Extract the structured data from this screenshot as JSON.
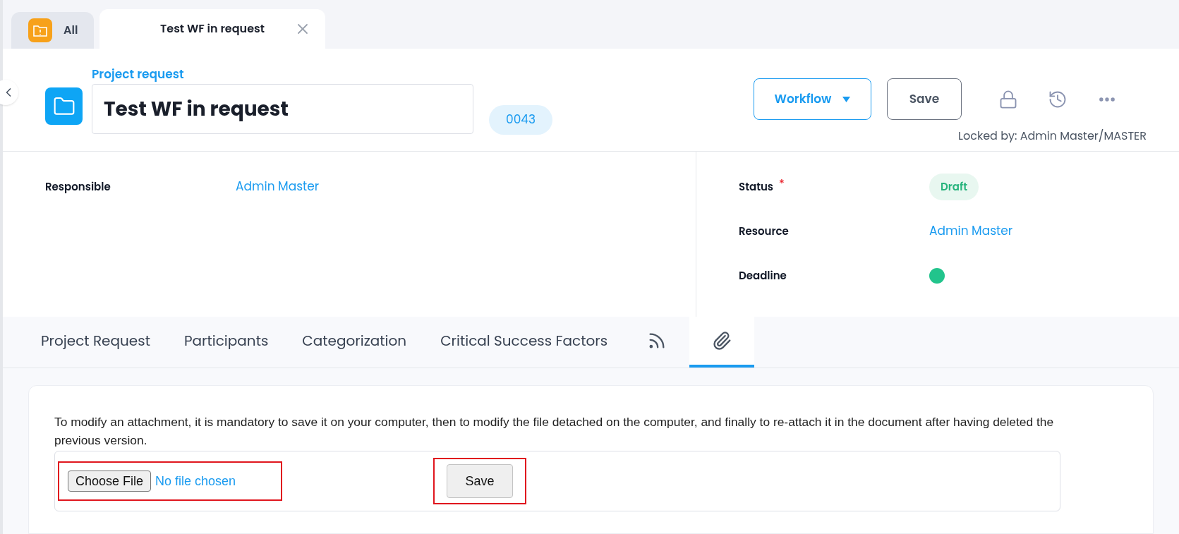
{
  "doc_tabs": [
    {
      "kind": "all",
      "label": "All",
      "selected": false
    },
    {
      "kind": "doc",
      "label": "Test WF in request",
      "selected": true
    }
  ],
  "header": {
    "type_label": "Project request",
    "title": "Test WF in request",
    "number": "0043",
    "workflow_button": "Workflow",
    "save_button": "Save",
    "locked_by": "Locked by: Admin Master/MASTER"
  },
  "left_fields": [
    {
      "label": "Responsible",
      "kind": "link",
      "value": "Admin Master"
    }
  ],
  "right_fields": [
    {
      "label": "Status",
      "kind": "badge",
      "value": "Draft",
      "required_mark": "*"
    },
    {
      "label": "Resource",
      "kind": "link",
      "value": "Admin Master"
    },
    {
      "label": "Deadline",
      "kind": "dot",
      "color": "#22c48c"
    }
  ],
  "section_tabs": [
    {
      "kind": "text",
      "label": "Project Request",
      "selected": false
    },
    {
      "kind": "text",
      "label": "Participants",
      "selected": false
    },
    {
      "kind": "text",
      "label": "Categorization",
      "selected": false
    },
    {
      "kind": "text",
      "label": "Critical Success Factors",
      "selected": false
    },
    {
      "kind": "feed",
      "selected": false
    },
    {
      "kind": "attachment",
      "selected": true
    }
  ],
  "attachments": {
    "note": "To modify an attachment, it is mandatory to save it on your computer, then to modify the file detached on the computer, and finally to re-attach it in the document after having deleted the previous version.",
    "choose_button": "Choose File",
    "file_status": "No file chosen",
    "save_button": "Save"
  }
}
